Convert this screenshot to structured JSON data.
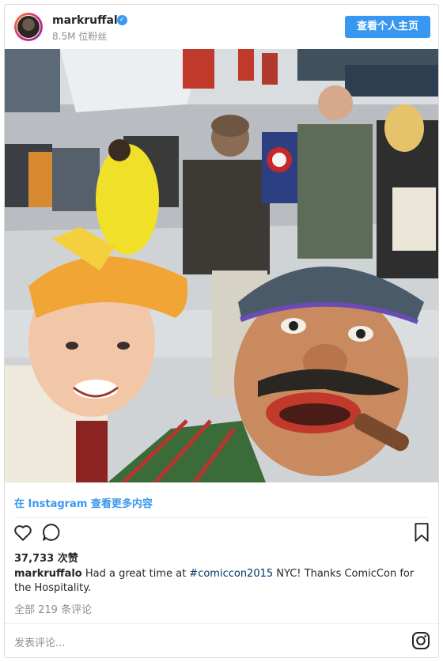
{
  "header": {
    "username": "markruffalo",
    "verified_glyph": "✓",
    "followers": "8.5M 位粉丝",
    "profile_button": "查看个人主页"
  },
  "photo": {
    "description_icon": "selfie-photo"
  },
  "links": {
    "view_more": "在 Instagram 查看更多内容"
  },
  "actions": {
    "like_icon": "heart-icon",
    "comment_icon": "comment-bubble-icon",
    "save_icon": "bookmark-icon"
  },
  "stats": {
    "likes": "37,733 次赞"
  },
  "caption": {
    "username": "markruffalo",
    "text_before": " Had a great time at ",
    "hashtag": "#comiccon2015",
    "text_after": " NYC! Thanks ComicCon for the Hospitality."
  },
  "comments": {
    "view_all": "全部 219 条评论"
  },
  "comment_box": {
    "placeholder": "发表评论..."
  },
  "colors": {
    "accent": "#3897f0",
    "text": "#262626",
    "muted": "#8e8e8e"
  }
}
